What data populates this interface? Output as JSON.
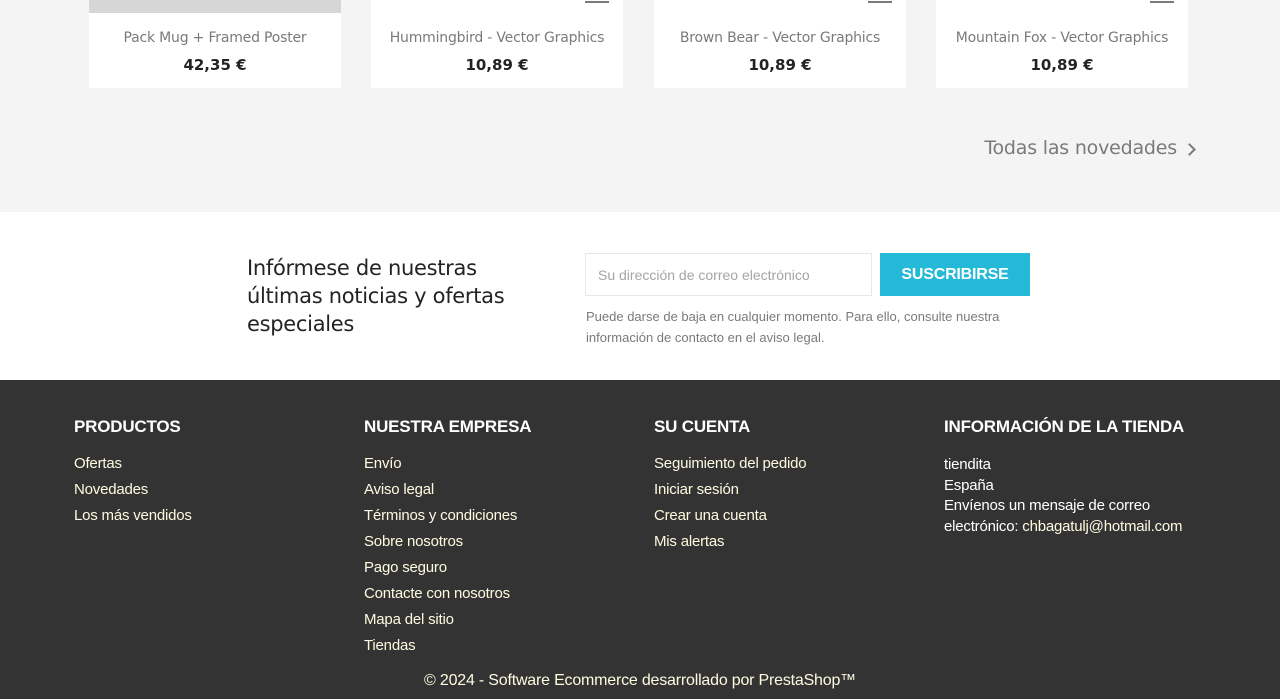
{
  "products": [
    {
      "name": "Pack Mug + Framed Poster",
      "price": "42,35 €"
    },
    {
      "name": "Hummingbird - Vector Graphics",
      "price": "10,89 €"
    },
    {
      "name": "Brown Bear - Vector Graphics",
      "price": "10,89 €"
    },
    {
      "name": "Mountain Fox - Vector Graphics",
      "price": "10,89 €"
    }
  ],
  "all_new_link": "Todas las novedades",
  "newsletter": {
    "title": "Infórmese de nuestras últimas noticias y ofertas especiales",
    "placeholder": "Su dirección de correo electrónico",
    "button": "SUSCRIBIRSE",
    "note": "Puede darse de baja en cualquier momento. Para ello, consulte nuestra información de contacto en el aviso legal."
  },
  "footer": {
    "productos": {
      "title": "PRODUCTOS",
      "items": [
        "Ofertas",
        "Novedades",
        "Los más vendidos"
      ]
    },
    "empresa": {
      "title": "NUESTRA EMPRESA",
      "items": [
        "Envío",
        "Aviso legal",
        "Términos y condiciones",
        "Sobre nosotros",
        "Pago seguro",
        "Contacte con nosotros",
        "Mapa del sitio",
        "Tiendas"
      ]
    },
    "cuenta": {
      "title": "SU CUENTA",
      "items": [
        "Seguimiento del pedido",
        "Iniciar sesión",
        "Crear una cuenta",
        "Mis alertas"
      ]
    },
    "tienda": {
      "title": "INFORMACIÓN DE LA TIENDA",
      "name": "tiendita",
      "country": "España",
      "email_label": "Envíenos un mensaje de correo electrónico:",
      "email": "chbagatulj@hotmail.com"
    },
    "copyright": "© 2024 - Software Ecommerce desarrollado por PrestaShop™"
  }
}
